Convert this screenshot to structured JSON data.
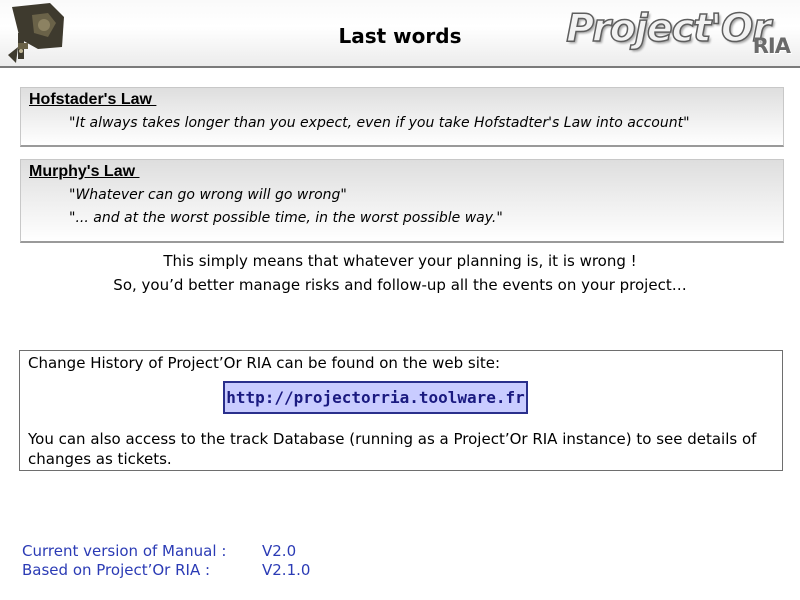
{
  "header": {
    "title": "Last words",
    "brand_main": "Project'Or",
    "brand_sub": "RIA",
    "logo_icon": "camera-tripod-logo-icon"
  },
  "laws": [
    {
      "title": "Hofstader's Law ",
      "quotes": [
        "\"It always takes longer than you expect, even if you take Hofstadter's Law into account\""
      ]
    },
    {
      "title": "Murphy's Law ",
      "quotes": [
        "\"Whatever can go wrong will go wrong\"",
        "\"... and at the worst possible time, in the worst possible way.\""
      ]
    }
  ],
  "summary": {
    "line1": "This simply means that whatever your planning is, it is wrong !",
    "line2": "So, you’d better manage risks and follow-up all the events on your project…"
  },
  "history": {
    "text": "Change History of Project’Or RIA can be found on the web site:",
    "link": "http://projectorria.toolware.fr",
    "text2": "You can also access to the track Database (running as a Project’Or RIA instance) to see details of changes as tickets."
  },
  "version": {
    "manual_label": "Current version of Manual :",
    "manual_value": "V2.0",
    "based_label": "Based on Project’Or RIA :",
    "based_value": "V2.1.0"
  },
  "colors": {
    "accent_blue": "#2b3bb5",
    "link_bg": "#c9ccff",
    "link_border": "#2a2f8c"
  }
}
